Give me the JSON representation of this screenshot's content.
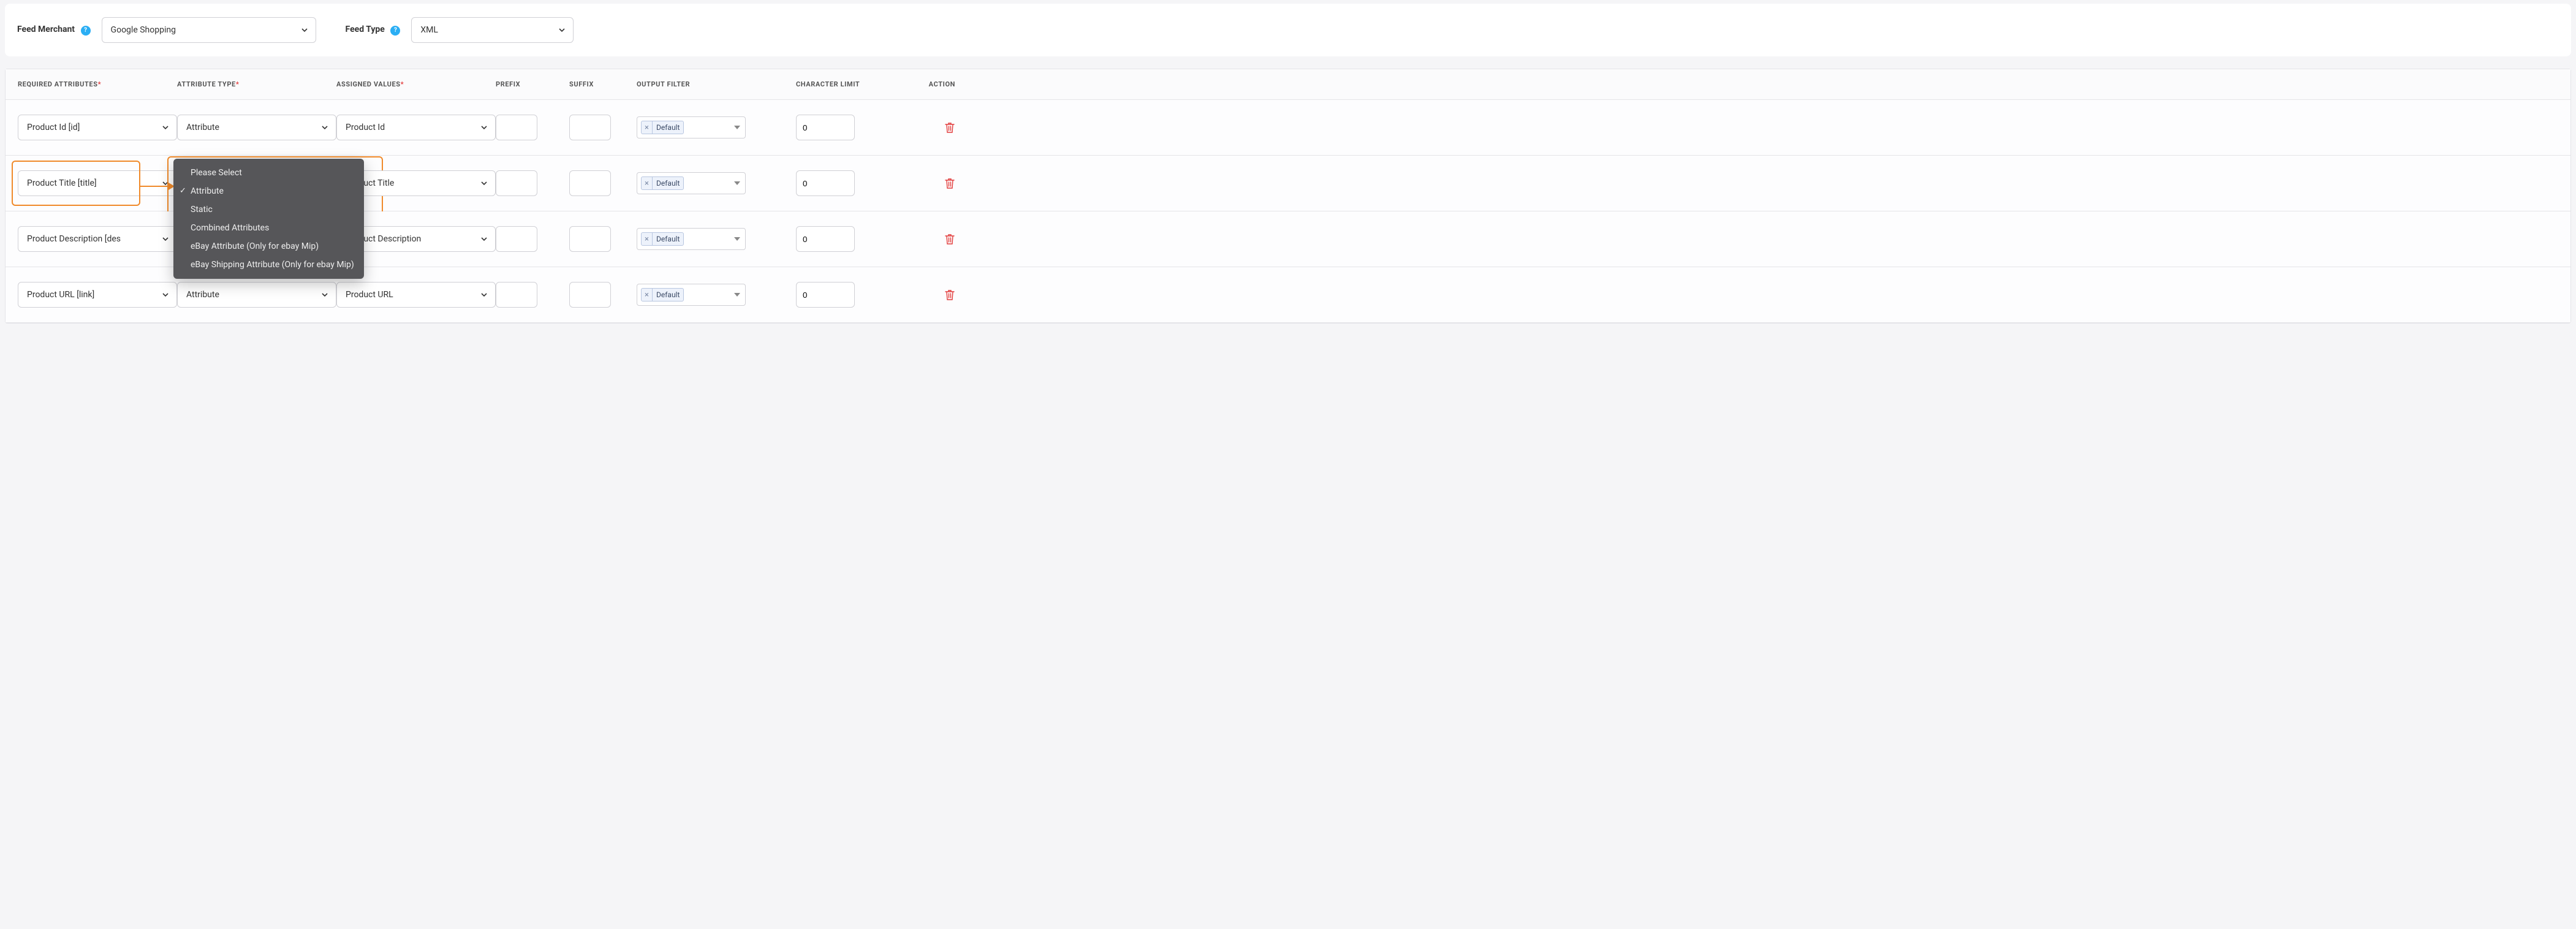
{
  "top": {
    "feed_merchant_label": "Feed Merchant",
    "feed_merchant_value": "Google Shopping",
    "feed_type_label": "Feed Type",
    "feed_type_value": "XML"
  },
  "columns": {
    "required_attributes": "REQUIRED ATTRIBUTES",
    "attribute_type": "ATTRIBUTE TYPE",
    "assigned_values": "ASSIGNED VALUES",
    "prefix": "PREFIX",
    "suffix": "SUFFIX",
    "output_filter": "OUTPUT FILTER",
    "character_limit": "CHARACTER LIMIT",
    "action": "ACTION"
  },
  "rows": [
    {
      "required_attribute": "Product Id [id]",
      "attribute_type": "Attribute",
      "assigned_value": "Product Id",
      "prefix": "",
      "suffix": "",
      "output_filter_tag": "Default",
      "character_limit": "0"
    },
    {
      "required_attribute": "Product Title [title]",
      "attribute_type": "Attribute",
      "assigned_value": "Product Title",
      "prefix": "",
      "suffix": "",
      "output_filter_tag": "Default",
      "character_limit": "0"
    },
    {
      "required_attribute": "Product Description [des",
      "attribute_type": "Attribute",
      "assigned_value": "Product Description",
      "prefix": "",
      "suffix": "",
      "output_filter_tag": "Default",
      "character_limit": "0"
    },
    {
      "required_attribute": "Product URL [link]",
      "attribute_type": "Attribute",
      "assigned_value": "Product URL",
      "prefix": "",
      "suffix": "",
      "output_filter_tag": "Default",
      "character_limit": "0"
    }
  ],
  "dropdown": {
    "options": [
      "Please Select",
      "Attribute",
      "Static",
      "Combined Attributes",
      "eBay Attribute (Only for ebay Mip)",
      "eBay Shipping Attribute (Only for ebay Mip)"
    ],
    "selected_index": 1
  }
}
